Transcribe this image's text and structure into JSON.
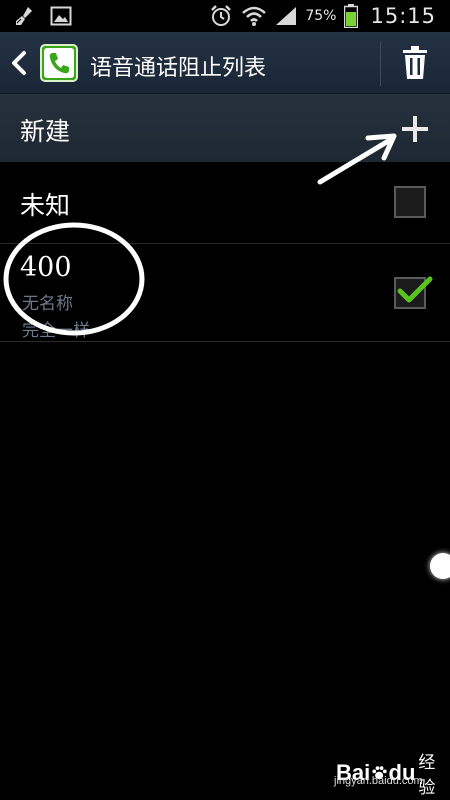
{
  "status_bar": {
    "left_icons": [
      "broom-icon",
      "image-icon"
    ],
    "right_icons": [
      "alarm-icon",
      "wifi-icon",
      "signal-icon",
      "battery-icon"
    ],
    "battery_percent": "75%",
    "time": "15:15"
  },
  "action_bar": {
    "title": "语音通话阻止列表",
    "back_icon": "chevron-left-icon",
    "app_icon": "phone-app-icon",
    "delete_icon": "trash-icon"
  },
  "new_row": {
    "label": "新建",
    "add_icon": "plus-icon"
  },
  "list": [
    {
      "title": "未知",
      "checked": false
    },
    {
      "title": "400",
      "subtitle1": "无名称",
      "subtitle2": "完全一样",
      "checked": true
    }
  ],
  "colors": {
    "action_bar": "#1d2a3a",
    "new_row": "#222c38",
    "check_green": "#5cc21e",
    "subtitle": "#6b7a8a"
  },
  "watermark": {
    "brand_left": "Bai",
    "brand_right": "du",
    "suffix": "经验",
    "url": "jingyan.baidu.com"
  }
}
